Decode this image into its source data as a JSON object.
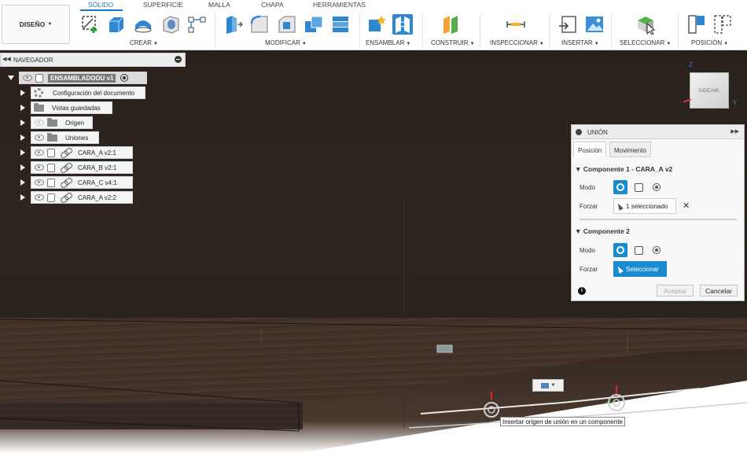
{
  "toolbar": {
    "design_button": "DISEÑO",
    "tabs": [
      {
        "label": "SÓLIDO",
        "active": true
      },
      {
        "label": "SUPERFICIE",
        "active": false
      },
      {
        "label": "MALLA",
        "active": false
      },
      {
        "label": "CHAPA",
        "active": false
      },
      {
        "label": "HERRAMIENTAS",
        "active": false
      }
    ],
    "groups": {
      "crear": "CREAR",
      "modificar": "MODIFICAR",
      "ensamblar": "ENSAMBLAR",
      "construir": "CONSTRUIR",
      "inspeccionar": "INSPECCIONAR",
      "insertar": "INSERTAR",
      "seleccionar": "SELECCIONAR",
      "posicion": "POSICIÓN"
    },
    "accent_color": "#1b75bc"
  },
  "navigator": {
    "title": "NAVEGADOR",
    "root": "ENSAMBLADOOU v1",
    "items": [
      {
        "label": "Configuración del documento",
        "icon": "gear-icon"
      },
      {
        "label": "Vistas guardadas",
        "icon": "folder-icon"
      },
      {
        "label": "Origen",
        "icon": "folder-icon"
      },
      {
        "label": "Uniones",
        "icon": "folder-icon"
      },
      {
        "label": "CARA_A v2:1",
        "icon": "component-icon"
      },
      {
        "label": "CARA_B v2:1",
        "icon": "component-icon"
      },
      {
        "label": "CARA_C v4:1",
        "icon": "component-icon"
      },
      {
        "label": "CARA_A v2:2",
        "icon": "component-icon"
      }
    ]
  },
  "viewcube": {
    "face": "SIDE/AR.",
    "axis_z": "Z",
    "axis_y": "Y"
  },
  "joint_dialog": {
    "title": "UNIÓN",
    "tabs": [
      "Posición",
      "Movimiento"
    ],
    "component1": {
      "title": "Componente 1 - CARA_A v2",
      "mode_label": "Modo",
      "snap_label": "Forzar",
      "snap_value": "1 seleccionado"
    },
    "component2": {
      "title": "Componente 2",
      "mode_label": "Modo",
      "snap_label": "Forzar",
      "snap_value": "Seleccionar"
    },
    "ok_button": "Aceptar",
    "cancel_button": "Cancelar",
    "info_glyph": "i",
    "accent_color": "#1b8bd0"
  },
  "viewport": {
    "tooltip": "Insertar origen de unión en un componente"
  }
}
